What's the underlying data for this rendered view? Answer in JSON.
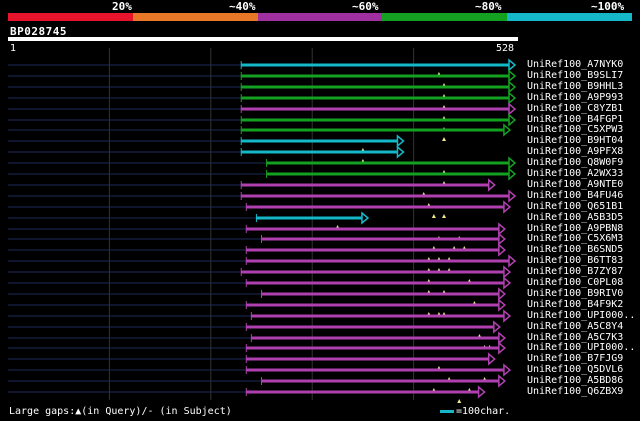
{
  "colors": {
    "bg": "#000000",
    "red": "#e8142c",
    "orange": "#e87828",
    "purple": "#a030a0",
    "green": "#14a020",
    "cyan": "#14b8c8",
    "magenta": "#b040b0",
    "track": "#1e2a5a",
    "marker": "#f0e68c"
  },
  "scale": {
    "labels": [
      "20%",
      "~40%",
      "~60%",
      "~80%",
      "~100%"
    ]
  },
  "query": {
    "name": "BP028745",
    "start": "1",
    "end": "528",
    "length": 528
  },
  "legend": {
    "gaps_text": "Large gaps:▲(in Query)/- (in Subject)",
    "scale_text": "=100char."
  },
  "hits": [
    {
      "label": "UniRef100_A7NYK0",
      "color": "cyan",
      "start": 0.46,
      "end": 1.0,
      "gaps": [
        0.85
      ]
    },
    {
      "label": "UniRef100_B9SLI7",
      "color": "green",
      "start": 0.46,
      "end": 1.0,
      "gaps": [
        0.86
      ]
    },
    {
      "label": "UniRef100_B9HHL3",
      "color": "green",
      "start": 0.46,
      "end": 1.0,
      "gaps": [
        0.86
      ]
    },
    {
      "label": "UniRef100_A9P993",
      "color": "green",
      "start": 0.46,
      "end": 1.0,
      "gaps": [
        0.86
      ]
    },
    {
      "label": "UniRef100_C8YZB1",
      "color": "magenta",
      "start": 0.46,
      "end": 1.0,
      "gaps": [
        0.86
      ]
    },
    {
      "label": "UniRef100_B4FGP1",
      "color": "green",
      "start": 0.46,
      "end": 1.0,
      "gaps": [
        0.86
      ]
    },
    {
      "label": "UniRef100_C5XPW3",
      "color": "green",
      "start": 0.46,
      "end": 0.99,
      "gaps": [
        0.86
      ]
    },
    {
      "label": "UniRef100_B9HT04",
      "color": "cyan",
      "start": 0.46,
      "end": 0.78,
      "gaps": [
        0.7
      ]
    },
    {
      "label": "UniRef100_A9PFX8",
      "color": "cyan",
      "start": 0.46,
      "end": 0.78,
      "gaps": [
        0.7
      ]
    },
    {
      "label": "UniRef100_Q8W0F9",
      "color": "green",
      "start": 0.51,
      "end": 1.0,
      "gaps": [
        0.86
      ]
    },
    {
      "label": "UniRef100_A2WX33",
      "color": "green",
      "start": 0.51,
      "end": 1.0,
      "gaps": [
        0.86
      ]
    },
    {
      "label": "UniRef100_A9NTE0",
      "color": "magenta",
      "start": 0.46,
      "end": 0.96,
      "gaps": [
        0.82
      ]
    },
    {
      "label": "UniRef100_B4FU46",
      "color": "magenta",
      "start": 0.46,
      "end": 1.0,
      "gaps": [
        0.83
      ]
    },
    {
      "label": "UniRef100_Q651B1",
      "color": "magenta",
      "start": 0.47,
      "end": 0.99,
      "gaps": [
        0.84,
        0.86
      ]
    },
    {
      "label": "UniRef100_A5B3D5",
      "color": "cyan",
      "start": 0.49,
      "end": 0.71,
      "gaps": [
        0.65
      ]
    },
    {
      "label": "UniRef100_A9PBN8",
      "color": "magenta",
      "start": 0.47,
      "end": 0.98,
      "gaps": [
        0.85,
        0.89
      ]
    },
    {
      "label": "UniRef100_C5X6M3",
      "color": "magenta",
      "start": 0.5,
      "end": 0.98,
      "gaps": [
        0.84,
        0.88,
        0.9
      ]
    },
    {
      "label": "UniRef100_B6SND5",
      "color": "magenta",
      "start": 0.47,
      "end": 0.98,
      "gaps": [
        0.83,
        0.85,
        0.87
      ]
    },
    {
      "label": "UniRef100_B6TT83",
      "color": "magenta",
      "start": 0.47,
      "end": 1.0,
      "gaps": [
        0.83,
        0.85,
        0.87
      ]
    },
    {
      "label": "UniRef100_B7ZY87",
      "color": "magenta",
      "start": 0.46,
      "end": 0.99,
      "gaps": [
        0.83,
        0.91
      ]
    },
    {
      "label": "UniRef100_C0PL08",
      "color": "magenta",
      "start": 0.47,
      "end": 0.99,
      "gaps": [
        0.83,
        0.86
      ]
    },
    {
      "label": "UniRef100_B9RIV0",
      "color": "magenta",
      "start": 0.5,
      "end": 0.98,
      "gaps": [
        0.92
      ]
    },
    {
      "label": "UniRef100_B4F9K2",
      "color": "magenta",
      "start": 0.47,
      "end": 0.98,
      "gaps": [
        0.83,
        0.85,
        0.86
      ]
    },
    {
      "label": "UniRef100_UPI000..",
      "color": "magenta",
      "start": 0.48,
      "end": 0.99,
      "gaps": [
        0.96
      ]
    },
    {
      "label": "UniRef100_A5C8Y4",
      "color": "magenta",
      "start": 0.47,
      "end": 0.97,
      "gaps": [
        0.93
      ]
    },
    {
      "label": "UniRef100_A5C7K3",
      "color": "magenta",
      "start": 0.48,
      "end": 0.98,
      "gaps": [
        0.94,
        0.95
      ]
    },
    {
      "label": "UniRef100_UPI000..",
      "color": "magenta",
      "start": 0.47,
      "end": 0.98,
      "gaps": [
        0.95
      ]
    },
    {
      "label": "UniRef100_B7FJG9",
      "color": "magenta",
      "start": 0.47,
      "end": 0.96,
      "gaps": [
        0.85
      ]
    },
    {
      "label": "UniRef100_Q5DVL6",
      "color": "magenta",
      "start": 0.47,
      "end": 0.99,
      "gaps": [
        0.87,
        0.94
      ]
    },
    {
      "label": "UniRef100_A5BD86",
      "color": "magenta",
      "start": 0.5,
      "end": 0.98,
      "gaps": [
        0.84,
        0.91
      ]
    },
    {
      "label": "UniRef100_Q6ZBX9",
      "color": "magenta",
      "start": 0.47,
      "end": 0.94,
      "gaps": [
        0.89
      ]
    }
  ]
}
